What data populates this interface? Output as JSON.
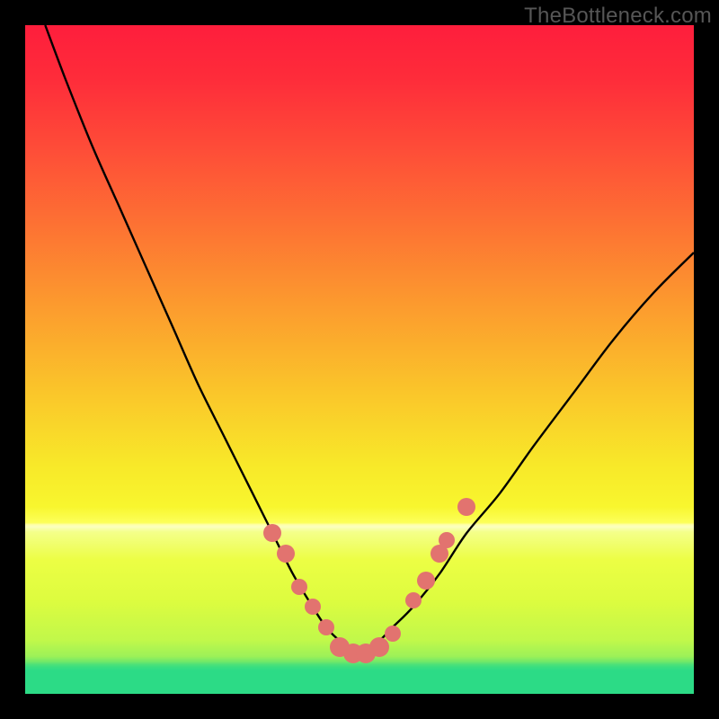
{
  "watermark": "TheBottleneck.com",
  "colors": {
    "marker": "#e2736f",
    "curve": "#000000",
    "frame": "#000000"
  },
  "chart_data": {
    "type": "line",
    "title": "",
    "xlabel": "",
    "ylabel": "",
    "xlim": [
      0,
      100
    ],
    "ylim": [
      0,
      100
    ],
    "grid": false,
    "series": [
      {
        "name": "bottleneck-curve",
        "x": [
          3,
          6,
          10,
          14,
          18,
          22,
          26,
          30,
          34,
          37,
          40,
          43,
          45,
          47,
          49,
          51,
          53,
          55,
          58,
          62,
          66,
          71,
          76,
          82,
          88,
          94,
          100
        ],
        "y": [
          100,
          92,
          82,
          73,
          64,
          55,
          46,
          38,
          30,
          24,
          18,
          13,
          10,
          8,
          7,
          7,
          8,
          10,
          13,
          18,
          24,
          30,
          37,
          45,
          53,
          60,
          66
        ]
      }
    ],
    "markers": [
      {
        "x": 37,
        "y": 24,
        "r": 10
      },
      {
        "x": 39,
        "y": 21,
        "r": 10
      },
      {
        "x": 41,
        "y": 16,
        "r": 9
      },
      {
        "x": 43,
        "y": 13,
        "r": 9
      },
      {
        "x": 45,
        "y": 10,
        "r": 9
      },
      {
        "x": 47,
        "y": 7,
        "r": 11
      },
      {
        "x": 49,
        "y": 6,
        "r": 11
      },
      {
        "x": 51,
        "y": 6,
        "r": 11
      },
      {
        "x": 53,
        "y": 7,
        "r": 11
      },
      {
        "x": 55,
        "y": 9,
        "r": 9
      },
      {
        "x": 58,
        "y": 14,
        "r": 9
      },
      {
        "x": 60,
        "y": 17,
        "r": 10
      },
      {
        "x": 62,
        "y": 21,
        "r": 10
      },
      {
        "x": 63,
        "y": 23,
        "r": 9
      },
      {
        "x": 66,
        "y": 28,
        "r": 10
      }
    ],
    "gradient_stops": [
      {
        "pos": 0.0,
        "color": "#fe1e3c"
      },
      {
        "pos": 0.08,
        "color": "#fe2c3a"
      },
      {
        "pos": 0.18,
        "color": "#fe4b38"
      },
      {
        "pos": 0.3,
        "color": "#fd7233"
      },
      {
        "pos": 0.42,
        "color": "#fc9b2e"
      },
      {
        "pos": 0.55,
        "color": "#fac62a"
      },
      {
        "pos": 0.66,
        "color": "#f8e929"
      },
      {
        "pos": 0.72,
        "color": "#f8f62e"
      },
      {
        "pos": 0.744,
        "color": "#fcff59"
      },
      {
        "pos": 0.747,
        "color": "#feffa8"
      },
      {
        "pos": 0.75,
        "color": "#fbffc0"
      },
      {
        "pos": 0.758,
        "color": "#f4ff8a"
      },
      {
        "pos": 0.8,
        "color": "#ecfe44"
      },
      {
        "pos": 0.86,
        "color": "#ddfc3f"
      },
      {
        "pos": 0.92,
        "color": "#c1f84a"
      },
      {
        "pos": 0.944,
        "color": "#9cf158"
      },
      {
        "pos": 0.952,
        "color": "#70e869"
      },
      {
        "pos": 0.956,
        "color": "#4ee178"
      },
      {
        "pos": 0.96,
        "color": "#3ade80"
      },
      {
        "pos": 0.965,
        "color": "#2cdb86"
      },
      {
        "pos": 1.0,
        "color": "#2cdb86"
      }
    ]
  }
}
